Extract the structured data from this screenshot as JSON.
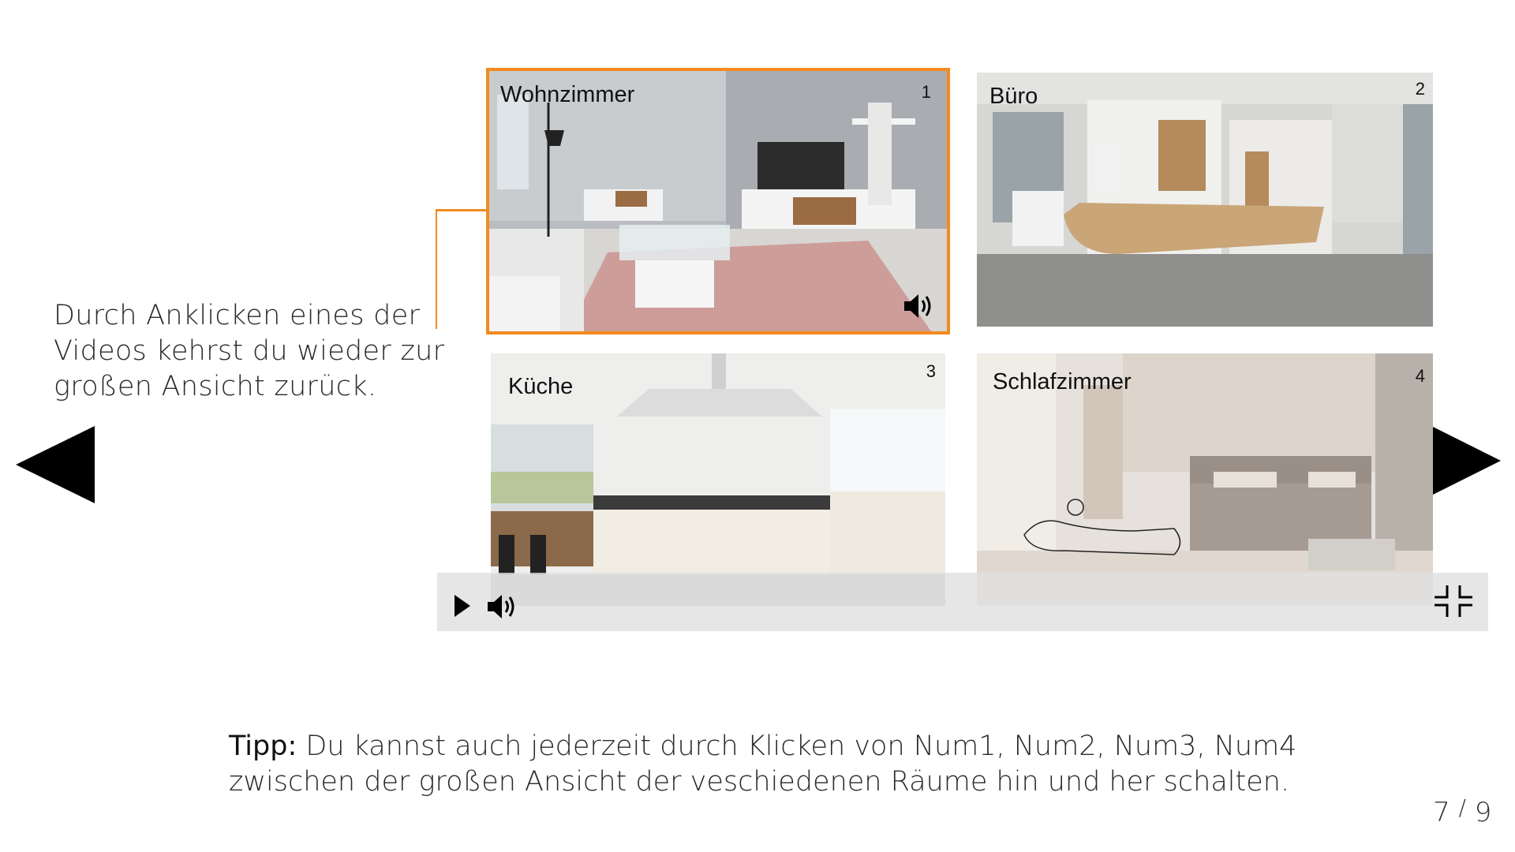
{
  "callout": {
    "line1": "Durch Anklicken eines der",
    "line2": "Videos kehrst du wieder zur",
    "line3": "großen Ansicht zurück."
  },
  "tiles": [
    {
      "label": "Wohnzimmer",
      "number": "1",
      "active": true,
      "has_volume_icon": true
    },
    {
      "label": "Büro",
      "number": "2",
      "active": false
    },
    {
      "label": "Küche",
      "number": "3",
      "active": false
    },
    {
      "label": "Schlafzimmer",
      "number": "4",
      "active": false
    }
  ],
  "controls": {
    "play_icon": "play-icon",
    "volume_icon": "volume-icon",
    "collapse_icon": "collapse-icon"
  },
  "navigation": {
    "prev_icon": "arrow-left-icon",
    "next_icon": "arrow-right-icon"
  },
  "tip": {
    "label": "Tipp:",
    "line1": " Du kannst auch jederzeit durch Klicken von Num1, Num2, Num3, Num4",
    "line2": "zwischen der großen Ansicht der veschiedenen Räume hin und her schalten."
  },
  "pagination": {
    "current": "7",
    "separator": "/",
    "total": "9"
  },
  "colors": {
    "accent": "#f28a1f",
    "control_bar": "#e0e0e0"
  }
}
